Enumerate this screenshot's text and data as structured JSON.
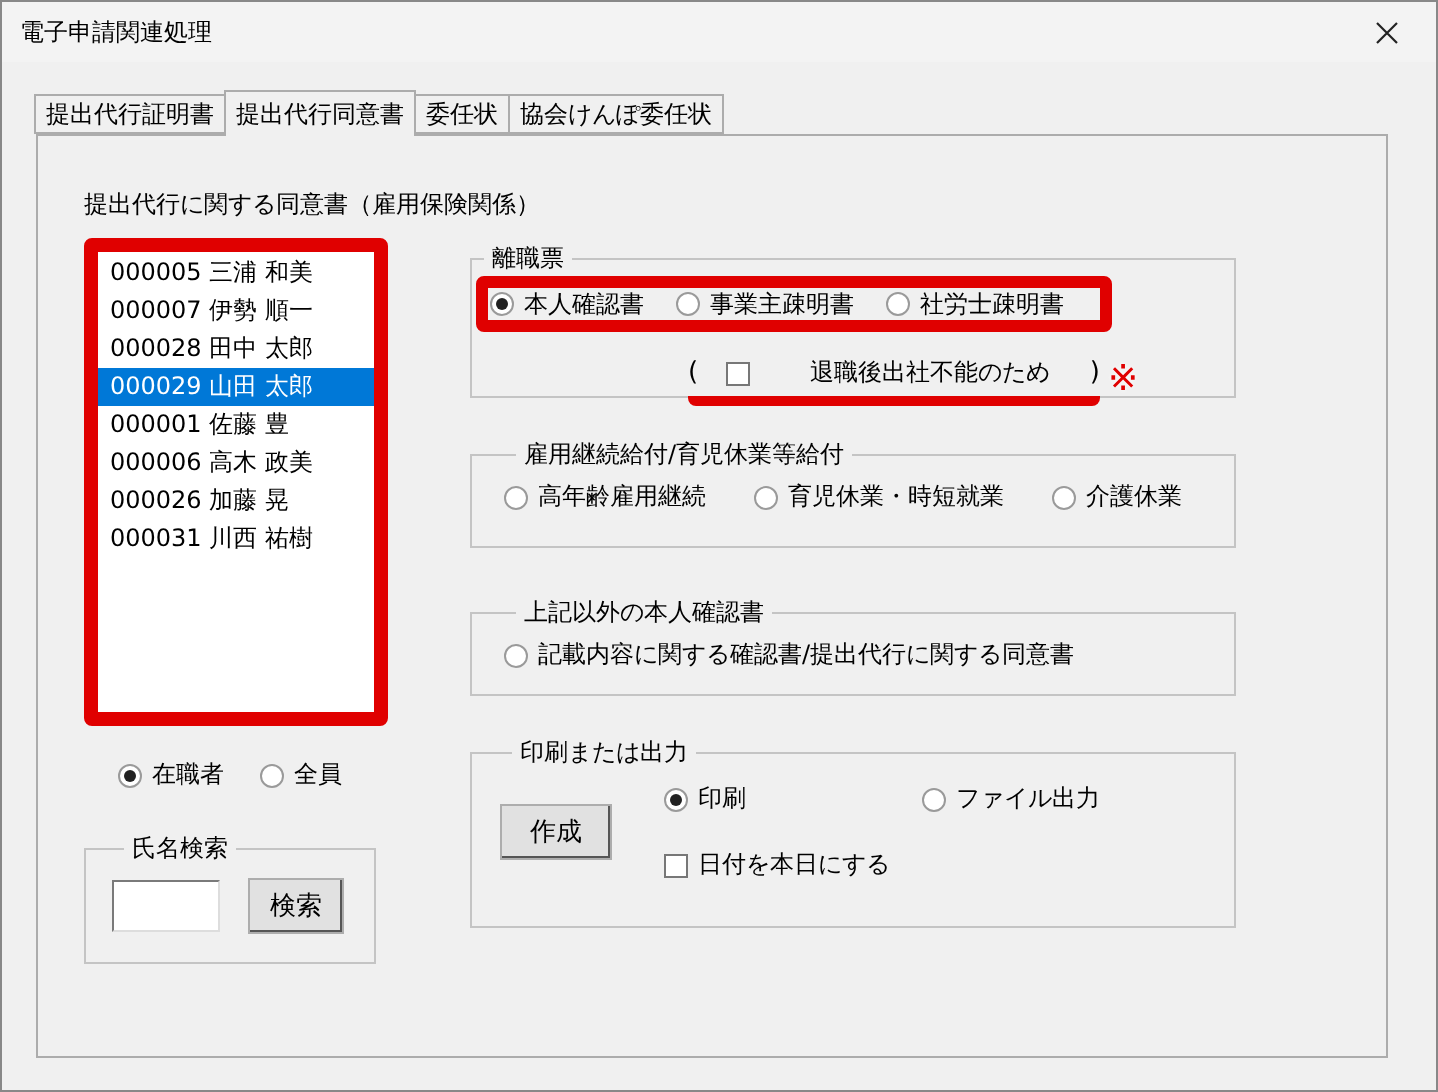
{
  "window": {
    "title": "電子申請関連処理"
  },
  "tabs": [
    {
      "label": "提出代行証明書",
      "selected": false
    },
    {
      "label": "提出代行同意書",
      "selected": true
    },
    {
      "label": "委任状",
      "selected": false
    },
    {
      "label": "協会けんぽ委任状",
      "selected": false
    }
  ],
  "heading": "提出代行に関する同意書（雇用保険関係）",
  "employee_list": {
    "highlighted": true,
    "items": [
      {
        "label": "000005 三浦 和美",
        "selected": false
      },
      {
        "label": "000007 伊勢 順一",
        "selected": false
      },
      {
        "label": "000028 田中 太郎",
        "selected": false
      },
      {
        "label": "000029 山田 太郎",
        "selected": true
      },
      {
        "label": "000001 佐藤 豊",
        "selected": false
      },
      {
        "label": "000006 高木 政美",
        "selected": false
      },
      {
        "label": "000026 加藤 晃",
        "selected": false
      },
      {
        "label": "000031 川西 祐樹",
        "selected": false
      }
    ]
  },
  "filter": [
    {
      "label": "在職者",
      "selected": true
    },
    {
      "label": "全員",
      "selected": false
    }
  ],
  "name_search": {
    "legend": "氏名検索",
    "button": "検索"
  },
  "separation_slip": {
    "legend": "離職票",
    "highlighted": true,
    "options": [
      {
        "label": "本人確認書",
        "selected": true
      },
      {
        "label": "事業主疎明書",
        "selected": false
      },
      {
        "label": "社労士疎明書",
        "selected": false
      }
    ],
    "checkbox": {
      "open": "(",
      "label": "退職後出社不能のため",
      "close": ")",
      "checked": false,
      "underlined": true,
      "note_mark": "※"
    }
  },
  "continuation": {
    "legend": "雇用継続給付/育児休業等給付",
    "options": [
      {
        "label": "高年齢雇用継続",
        "selected": false
      },
      {
        "label": "育児休業・時短就業",
        "selected": false
      },
      {
        "label": "介護休業",
        "selected": false
      }
    ]
  },
  "other_identity": {
    "legend": "上記以外の本人確認書",
    "options": [
      {
        "label": "記載内容に関する確認書/提出代行に関する同意書",
        "selected": false
      }
    ]
  },
  "output": {
    "legend": "印刷または出力",
    "button": "作成",
    "options": [
      {
        "label": "印刷",
        "selected": true
      },
      {
        "label": "ファイル出力",
        "selected": false
      }
    ],
    "date_checkbox": {
      "label": "日付を本日にする",
      "checked": false
    }
  }
}
